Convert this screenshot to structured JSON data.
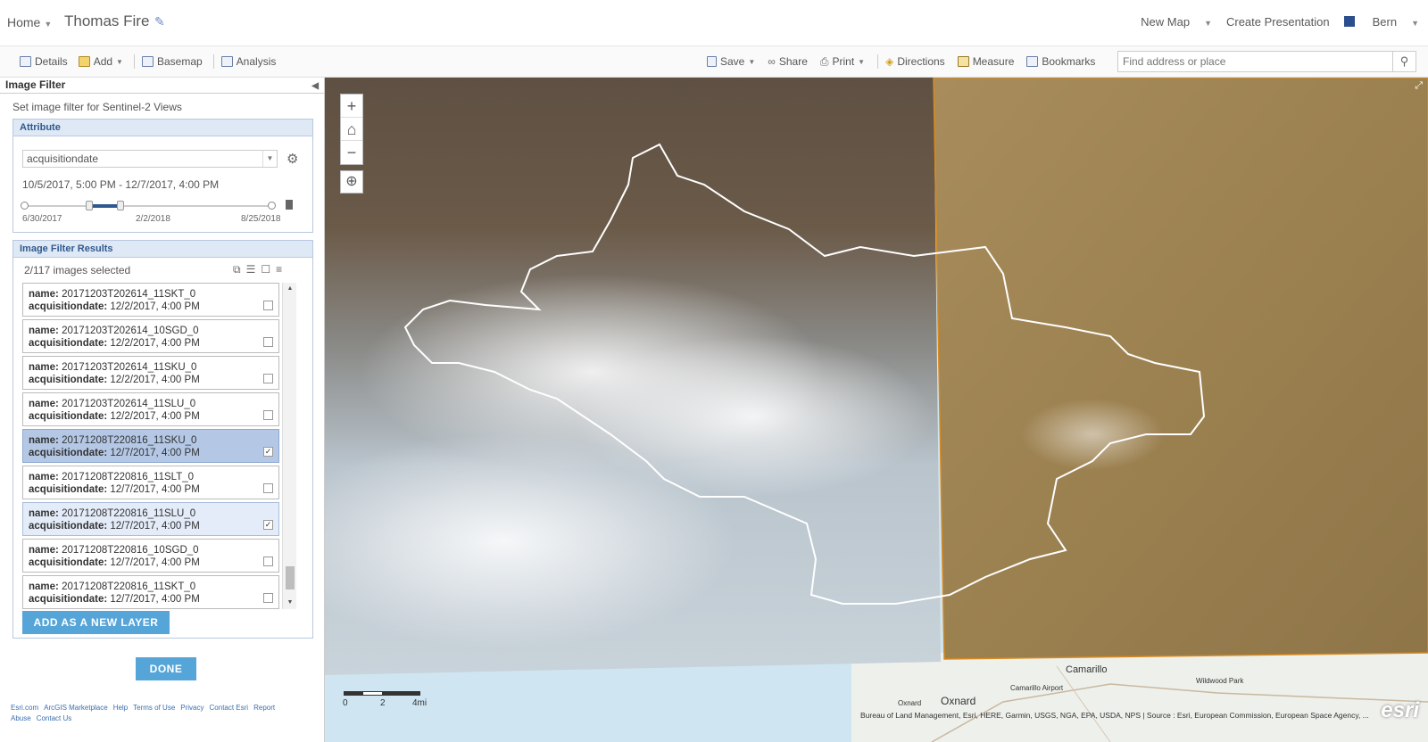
{
  "header": {
    "home_label": "Home",
    "map_title": "Thomas Fire",
    "new_map": "New Map",
    "create_presentation": "Create Presentation",
    "user": "Bern"
  },
  "toolbar": {
    "details": "Details",
    "add": "Add",
    "basemap": "Basemap",
    "analysis": "Analysis",
    "save": "Save",
    "share": "Share",
    "print": "Print",
    "directions": "Directions",
    "measure": "Measure",
    "bookmarks": "Bookmarks",
    "search_placeholder": "Find address or place"
  },
  "panel": {
    "title": "Image Filter",
    "subtitle": "Set image filter for Sentinel-2 Views",
    "attribute": {
      "heading": "Attribute",
      "field": "acquisitiondate",
      "range": "10/5/2017, 5:00 PM - 12/7/2017, 4:00 PM",
      "slider_min": "6/30/2017",
      "slider_mid": "2/2/2018",
      "slider_max": "8/25/2018"
    },
    "results": {
      "heading": "Image Filter Results",
      "count": "2/117 images selected",
      "name_key": "name:",
      "date_key": "acquisitiondate:",
      "items": [
        {
          "name": "20171203T202614_11SKT_0",
          "date": "12/2/2017, 4:00 PM",
          "checked": false,
          "state": ""
        },
        {
          "name": "20171203T202614_10SGD_0",
          "date": "12/2/2017, 4:00 PM",
          "checked": false,
          "state": ""
        },
        {
          "name": "20171203T202614_11SKU_0",
          "date": "12/2/2017, 4:00 PM",
          "checked": false,
          "state": ""
        },
        {
          "name": "20171203T202614_11SLU_0",
          "date": "12/2/2017, 4:00 PM",
          "checked": false,
          "state": ""
        },
        {
          "name": "20171208T220816_11SKU_0",
          "date": "12/7/2017, 4:00 PM",
          "checked": true,
          "state": "sel"
        },
        {
          "name": "20171208T220816_11SLT_0",
          "date": "12/7/2017, 4:00 PM",
          "checked": false,
          "state": ""
        },
        {
          "name": "20171208T220816_11SLU_0",
          "date": "12/7/2017, 4:00 PM",
          "checked": true,
          "state": "hov"
        },
        {
          "name": "20171208T220816_10SGD_0",
          "date": "12/7/2017, 4:00 PM",
          "checked": false,
          "state": ""
        },
        {
          "name": "20171208T220816_11SKT_0",
          "date": "12/7/2017, 4:00 PM",
          "checked": false,
          "state": ""
        }
      ],
      "add_layer_button": "ADD AS A NEW LAYER"
    },
    "done_button": "DONE",
    "footer_links": [
      "Esri.com",
      "ArcGIS Marketplace",
      "Help",
      "Terms of Use",
      "Privacy",
      "Contact Esri",
      "Report Abuse",
      "Contact Us"
    ]
  },
  "map": {
    "scale_labels": [
      "0",
      "2",
      "4mi"
    ],
    "attribution": "Bureau of Land Management, Esri, HERE, Garmin, USGS, NGA, EPA, USDA, NPS | Source : Esri, European Commission, European Space Agency, ...",
    "places": [
      "Camarillo",
      "Oxnard",
      "Camarillo Airport",
      "Oxnard",
      "Wildwood Park"
    ],
    "logo": "esri",
    "colors": {
      "burn_outline": "#ffffff",
      "right_tile_border": "#d98a1e",
      "ocean": "#cfe6f2"
    }
  }
}
